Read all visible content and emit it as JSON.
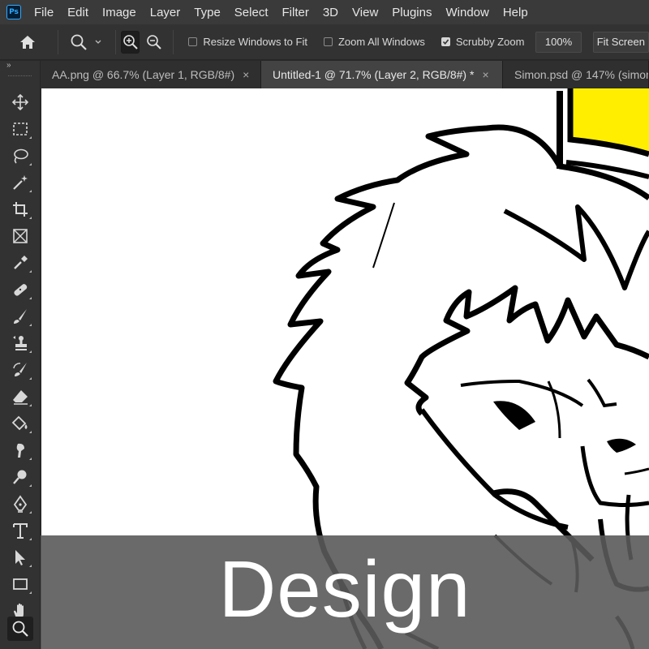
{
  "app": {
    "logo_text": "Ps"
  },
  "menu": [
    "File",
    "Edit",
    "Image",
    "Layer",
    "Type",
    "Select",
    "Filter",
    "3D",
    "View",
    "Plugins",
    "Window",
    "Help"
  ],
  "options": {
    "resize_windows_label": "Resize Windows to Fit",
    "resize_windows_checked": false,
    "zoom_all_label": "Zoom All Windows",
    "zoom_all_checked": false,
    "scrubby_label": "Scrubby Zoom",
    "scrubby_checked": true,
    "percent_button": "100%",
    "fit_screen_button": "Fit Screen"
  },
  "tabs": [
    {
      "label": "AA.png @ 66.7% (Layer 1, RGB/8#)",
      "close": "×",
      "active": false
    },
    {
      "label": "Untitled-1 @ 71.7% (Layer 2, RGB/8#) *",
      "close": "×",
      "active": true
    },
    {
      "label": "Simon.psd @ 147% (simon",
      "close": "",
      "active": false
    }
  ],
  "toolbar": {
    "collapse_glyph": "»",
    "tools": [
      "move",
      "marquee",
      "lasso",
      "magic-wand",
      "crop",
      "frame",
      "eyedropper",
      "healing-brush",
      "brush",
      "clone-stamp",
      "history-brush",
      "eraser",
      "paint-bucket",
      "smudge",
      "dodge",
      "pen",
      "type",
      "path-selection",
      "rectangle",
      "hand",
      "zoom"
    ],
    "active_tool": "zoom"
  },
  "canvas": {
    "caption": "Design",
    "accent_color": "#ffee00",
    "background": "#ffffff"
  }
}
